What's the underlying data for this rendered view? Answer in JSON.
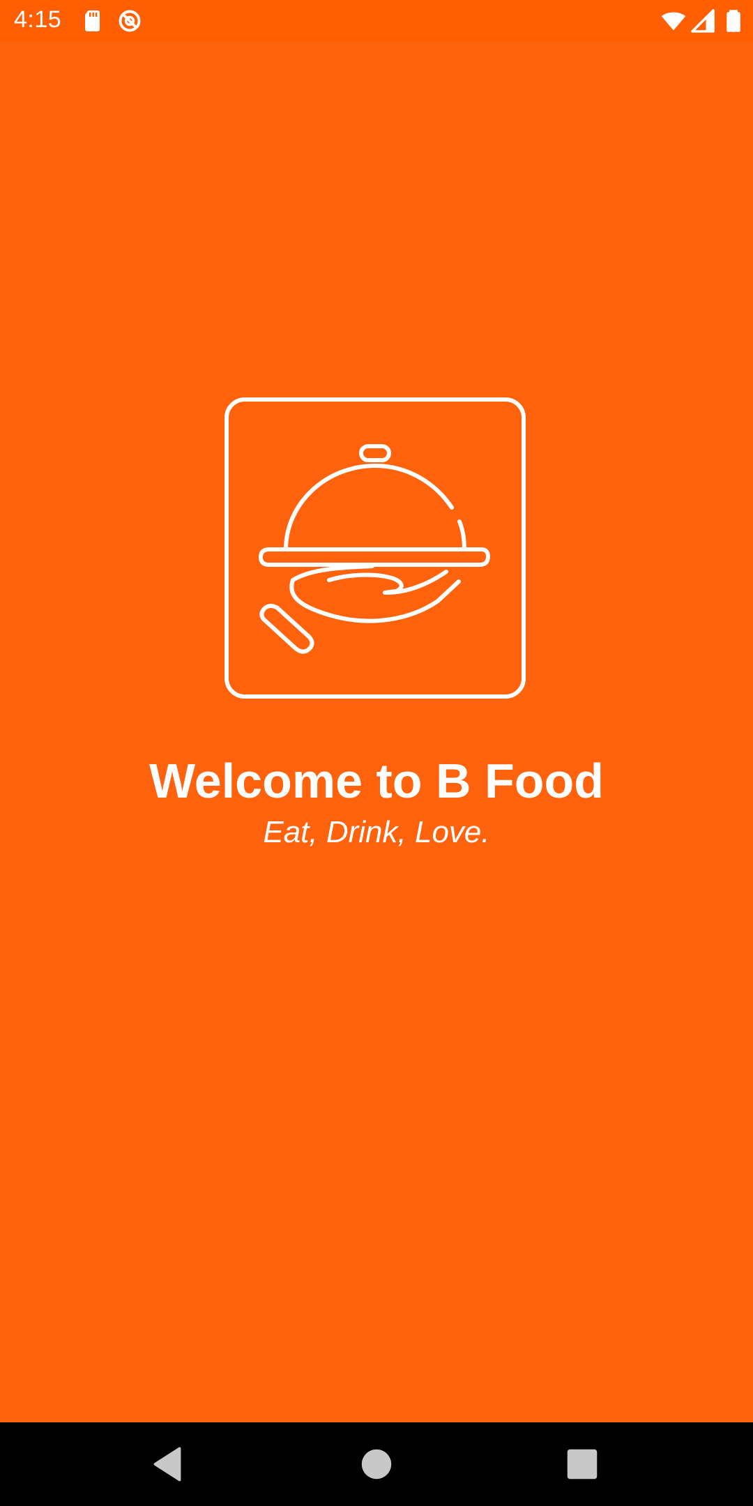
{
  "status_bar": {
    "time": "4:15",
    "icons": [
      "sd-card-icon",
      "sync-disabled-icon",
      "wifi-icon",
      "signal-icon",
      "battery-icon"
    ]
  },
  "splash": {
    "logo_icon": "cloche-serving-hand-icon",
    "title": "Welcome to B Food",
    "tagline": "Eat, Drink, Love."
  },
  "nav_bar": {
    "buttons": [
      "back-icon",
      "home-icon",
      "recents-icon"
    ]
  },
  "colors": {
    "background": "#FF620D",
    "status_bar": "#FF5E02",
    "foreground": "#FFFFFF",
    "nav_bar": "#000000"
  }
}
